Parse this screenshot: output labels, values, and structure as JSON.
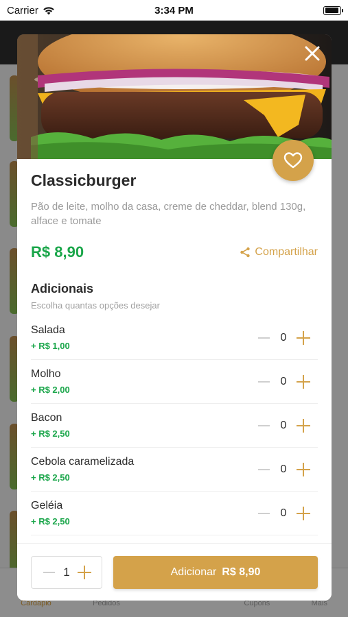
{
  "status_bar": {
    "carrier": "Carrier",
    "time": "3:34 PM"
  },
  "background": {
    "tabs": [
      "Cardápio",
      "Pedidos",
      "Cupons",
      "Mais"
    ]
  },
  "product": {
    "name": "Classicburger",
    "description": "Pão de leite, molho da casa, creme de cheddar, blend 130g, alface e tomate",
    "price": "R$ 8,90",
    "share_label": "Compartilhar"
  },
  "addons": {
    "title": "Adicionais",
    "subtitle": "Escolha quantas opções desejar",
    "items": [
      {
        "name": "Salada",
        "price": "+ R$ 1,00",
        "count": "0"
      },
      {
        "name": "Molho",
        "price": "+ R$ 2,00",
        "count": "0"
      },
      {
        "name": "Bacon",
        "price": "+ R$ 2,50",
        "count": "0"
      },
      {
        "name": "Cebola caramelizada",
        "price": "+ R$ 2,50",
        "count": "0"
      },
      {
        "name": "Geléia",
        "price": "+ R$ 2,50",
        "count": "0"
      }
    ]
  },
  "footer": {
    "quantity": "1",
    "add_label": "Adicionar",
    "add_total": "R$ 8,90"
  },
  "colors": {
    "accent": "#d4a24a",
    "price_green": "#1aa64a",
    "title_text": "#2b2b2b"
  },
  "icons": [
    "wifi-icon",
    "battery-icon",
    "close-icon",
    "heart-icon",
    "share-icon",
    "minus-icon",
    "plus-icon"
  ]
}
